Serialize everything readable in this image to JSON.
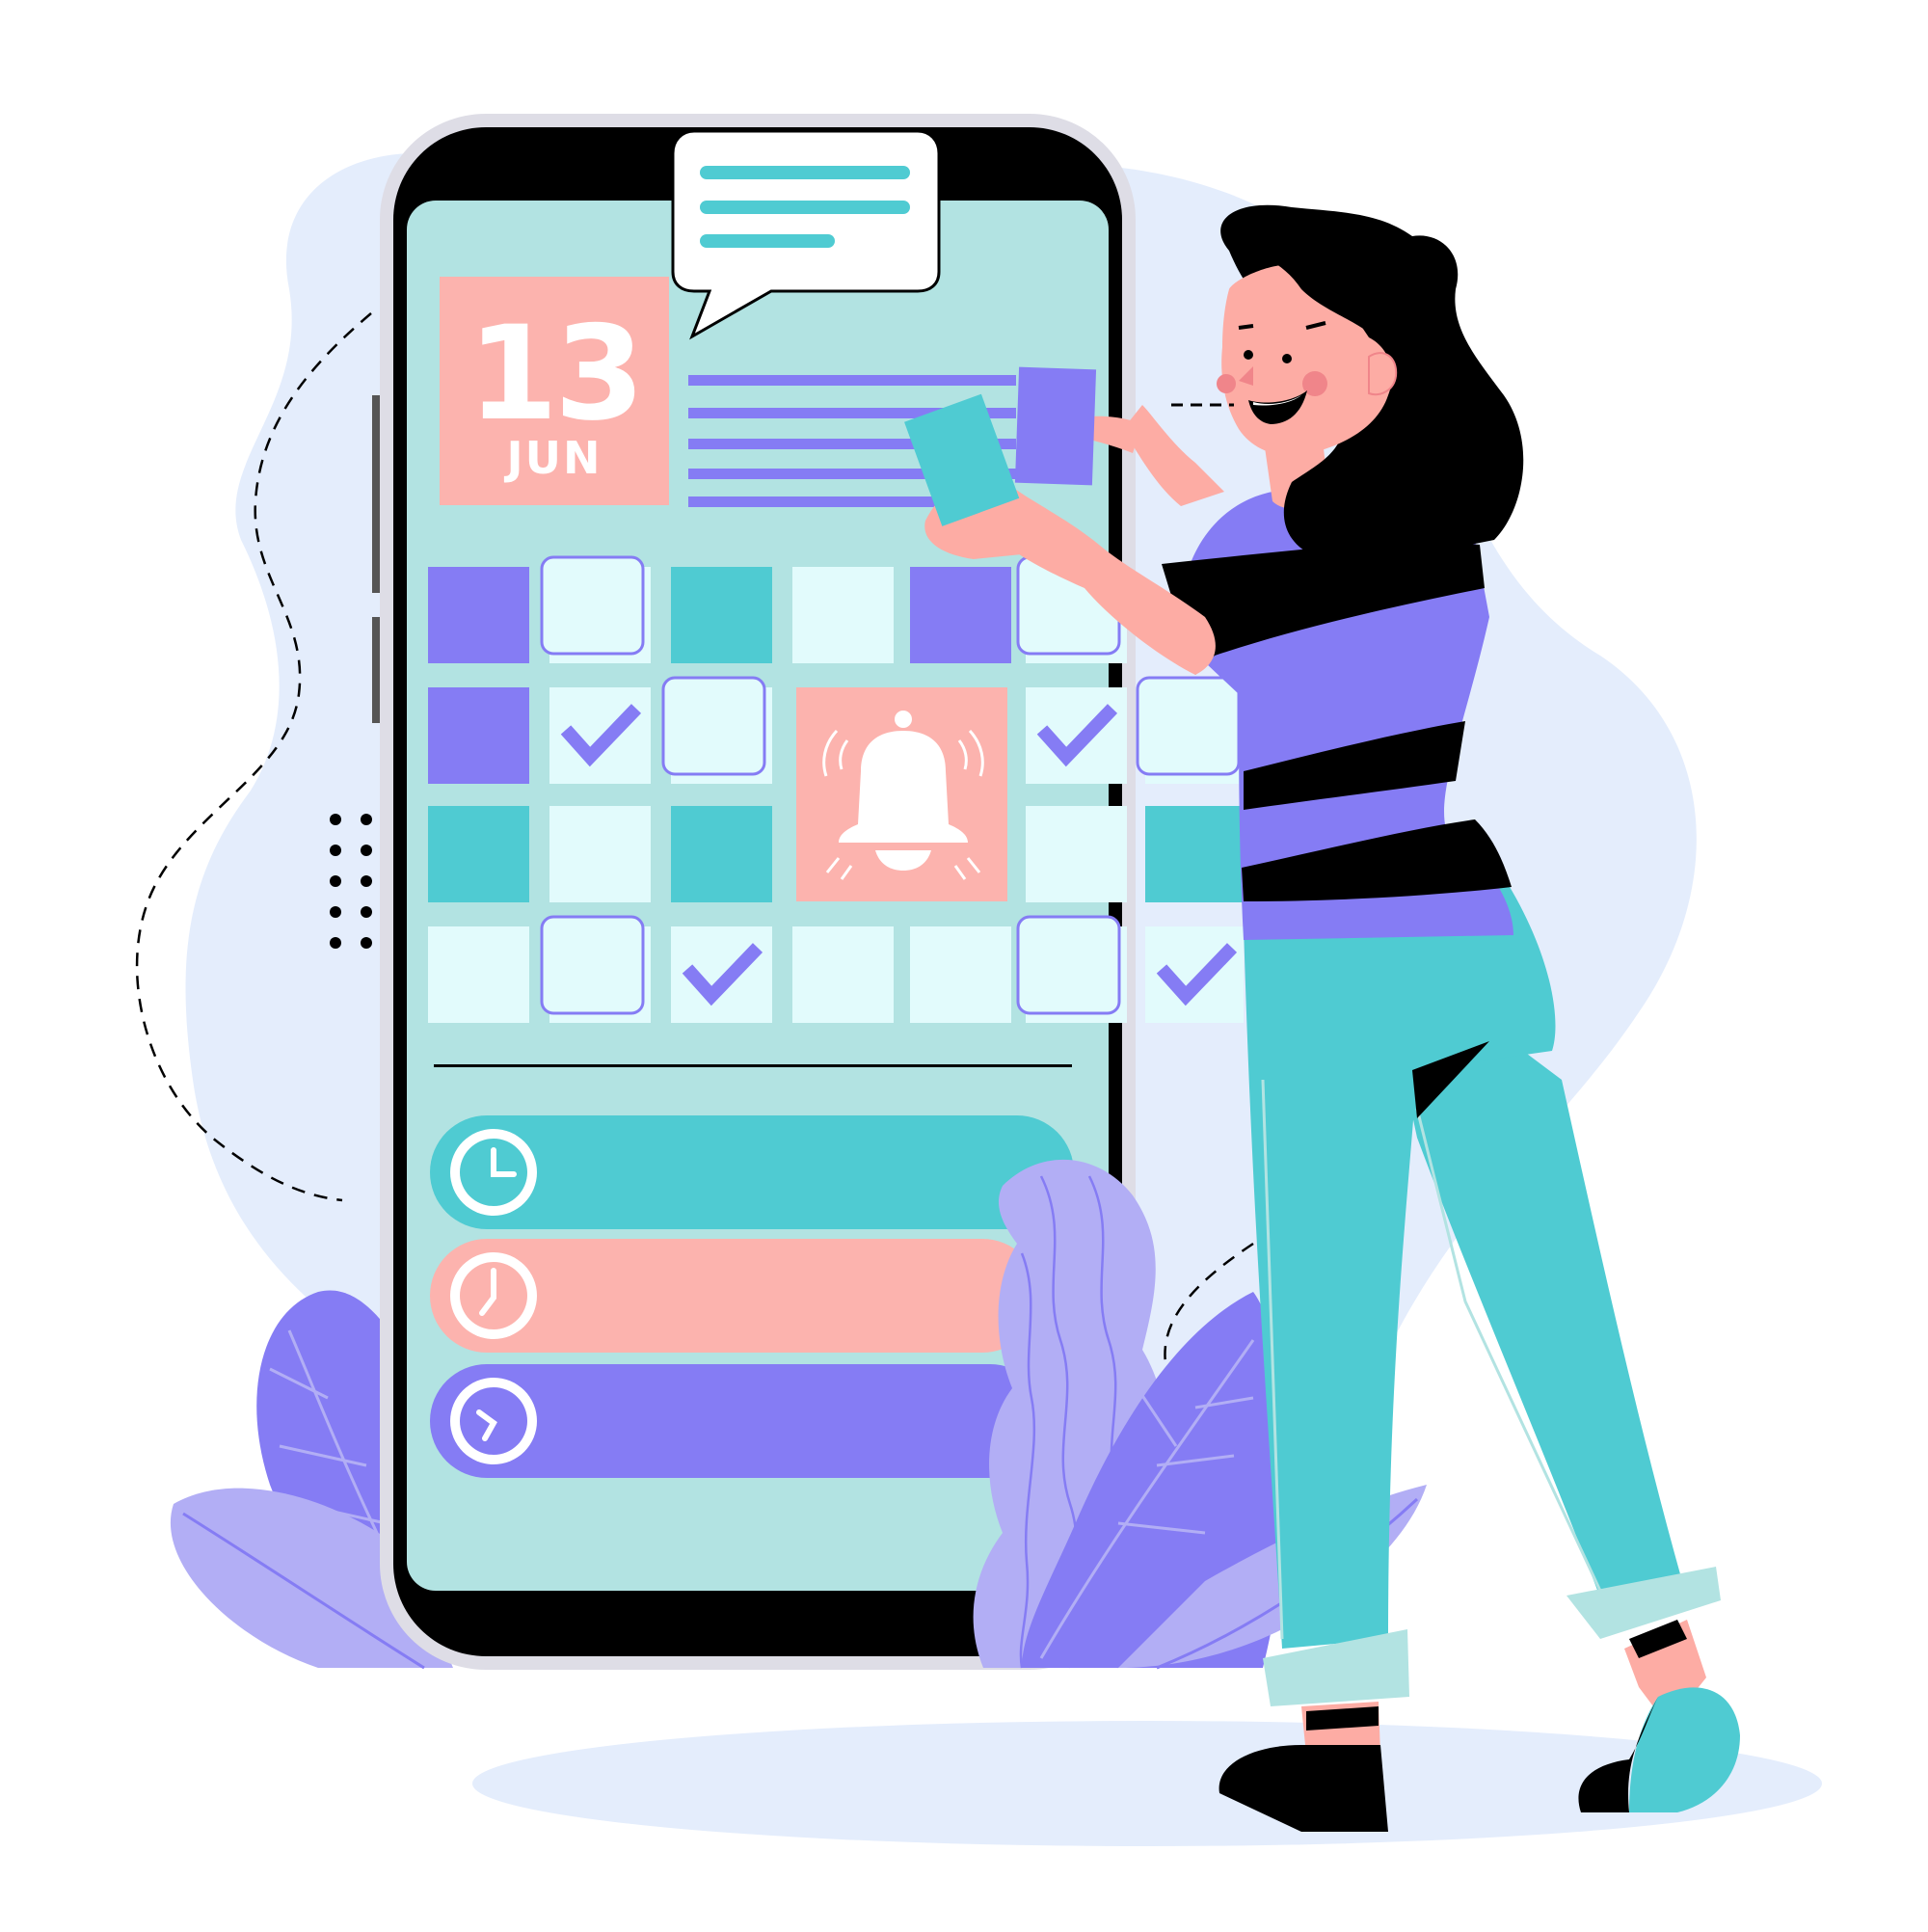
{
  "calendar_badge": {
    "day": "13",
    "month": "JUN"
  },
  "colors": {
    "background": "#ffffff",
    "blob": "#e4edfc",
    "phone_frame": "#000000",
    "phone_bezel": "#dedde6",
    "screen": "#b2e3e2",
    "purple": "#857cf4",
    "teal": "#4fcbd2",
    "pink": "#fcb3ae",
    "light_cell": "#e2fbfc",
    "leaf": "#b2aef5",
    "skin": "#fdaca4",
    "hair": "#000000"
  },
  "icons": {
    "message": "speech-bubble-icon",
    "alarm": "bell-icon",
    "check": "checkmark-icon",
    "time": "clock-icon"
  },
  "calendar_grid": {
    "rows": [
      [
        "purple",
        "light-outlined",
        "teal",
        "light",
        "purple",
        "light-outlined"
      ],
      [
        "purple",
        "light-check",
        "light-outlined",
        "bell",
        "bell",
        "light-check",
        "light-outlined"
      ],
      [
        "teal",
        "light",
        "teal",
        "bell",
        "bell",
        "light",
        "teal"
      ],
      [
        "light",
        "light-outlined",
        "light-check",
        "light",
        "light",
        "light-outlined",
        "light-check"
      ]
    ]
  },
  "schedule_items": [
    {
      "color": "teal",
      "icon": "clock-icon"
    },
    {
      "color": "pink",
      "icon": "clock-icon"
    },
    {
      "color": "purple",
      "icon": "clock-icon"
    }
  ]
}
